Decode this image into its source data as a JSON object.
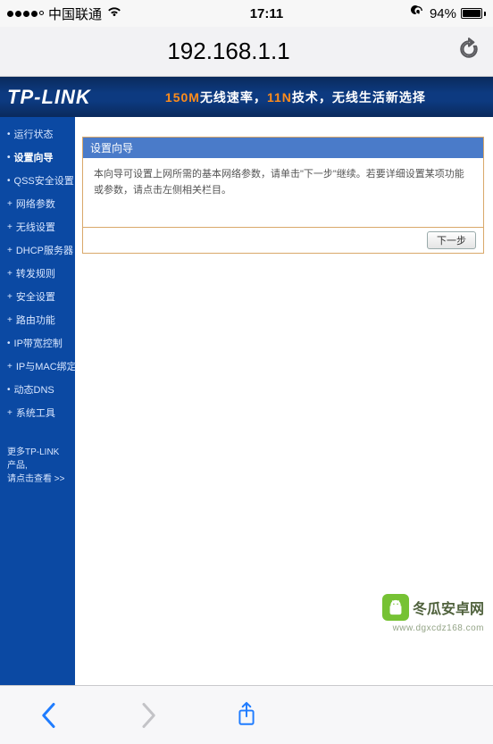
{
  "status": {
    "carrier": "中国联通",
    "time": "17:11",
    "battery_pct": "94%"
  },
  "safari": {
    "url": "192.168.1.1"
  },
  "router": {
    "brand": "TP-LINK",
    "slogan_prefix": "150M",
    "slogan_mid": "无线速率，",
    "slogan_accent": "11N",
    "slogan_suffix": "技术，无线生活新选择",
    "nav": [
      {
        "label": "运行状态",
        "active": false,
        "plus": false
      },
      {
        "label": "设置向导",
        "active": true,
        "plus": false
      },
      {
        "label": "QSS安全设置",
        "active": false,
        "plus": false
      },
      {
        "label": "网络参数",
        "active": false,
        "plus": true
      },
      {
        "label": "无线设置",
        "active": false,
        "plus": true
      },
      {
        "label": "DHCP服务器",
        "active": false,
        "plus": true
      },
      {
        "label": "转发规则",
        "active": false,
        "plus": true
      },
      {
        "label": "安全设置",
        "active": false,
        "plus": true
      },
      {
        "label": "路由功能",
        "active": false,
        "plus": true
      },
      {
        "label": "IP带宽控制",
        "active": false,
        "plus": false
      },
      {
        "label": "IP与MAC绑定",
        "active": false,
        "plus": true
      },
      {
        "label": "动态DNS",
        "active": false,
        "plus": false
      },
      {
        "label": "系统工具",
        "active": false,
        "plus": true
      }
    ],
    "more_line1": "更多TP-LINK产品,",
    "more_line2": "请点击查看 >>",
    "wizard": {
      "title": "设置向导",
      "body": "本向导可设置上网所需的基本网络参数，请单击\"下一步\"继续。若要详细设置某项功能或参数，请点击左侧相关栏目。",
      "next": "下一步"
    }
  },
  "watermark": {
    "text": "冬瓜安卓网",
    "sub": "www.dgxcdz168.com"
  }
}
